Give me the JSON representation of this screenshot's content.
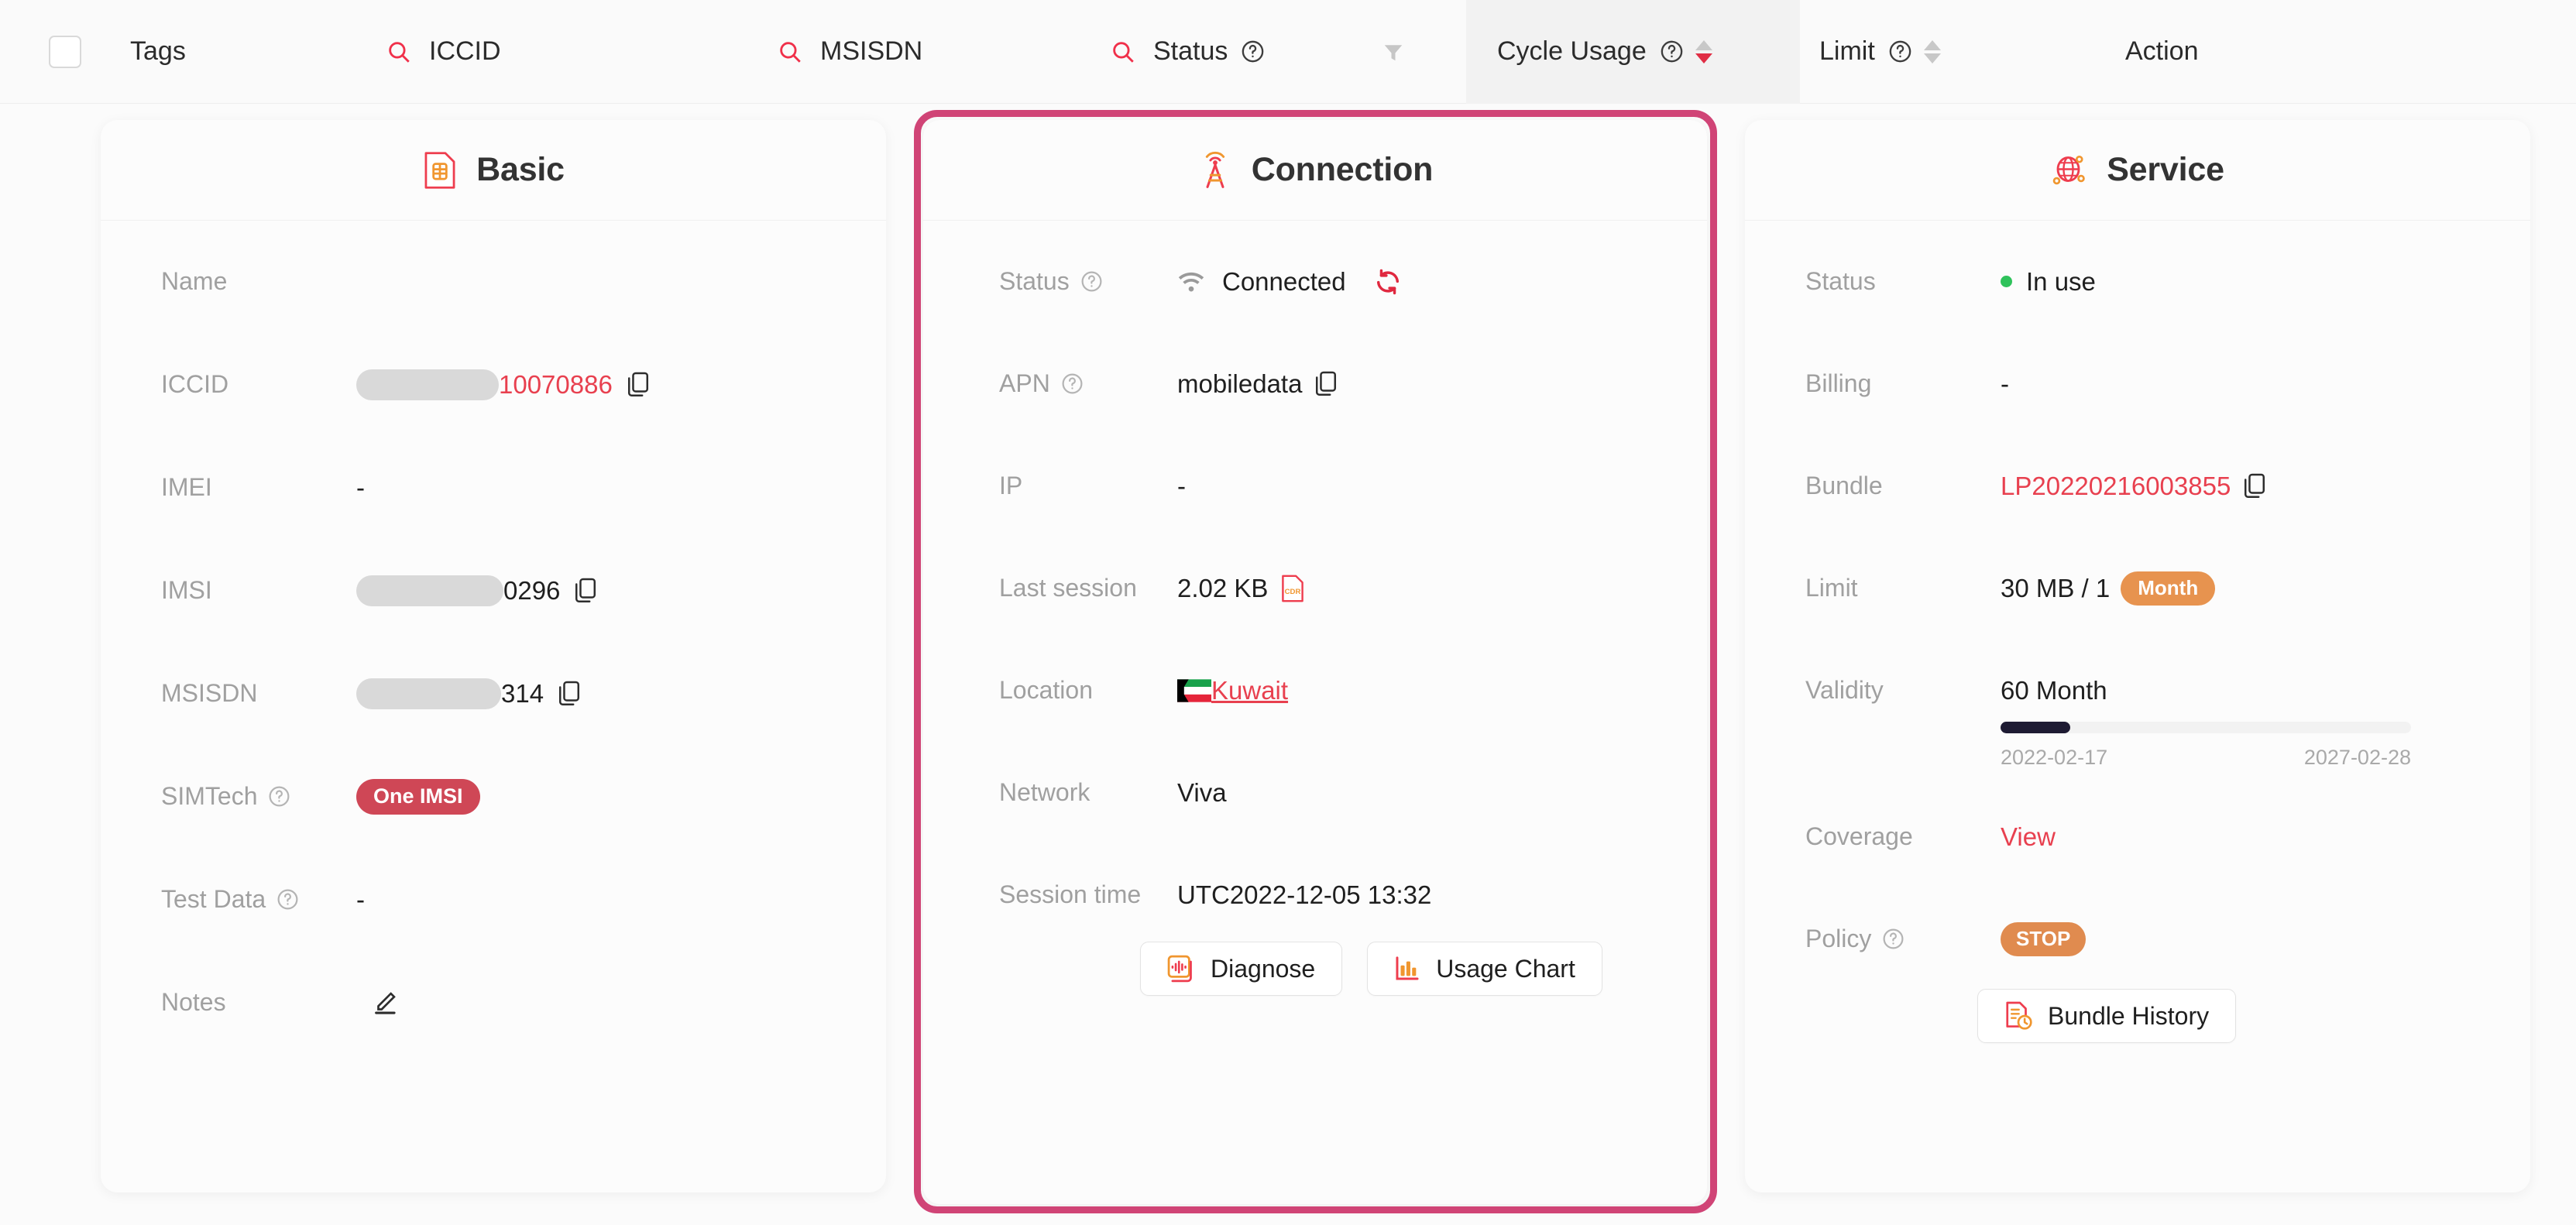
{
  "table_header": {
    "checkbox_checked": false,
    "columns": [
      {
        "label": "Tags",
        "icon": null,
        "help": false,
        "sort": false,
        "filter": false,
        "highlight": false
      },
      {
        "label": "ICCID",
        "icon": "search-icon",
        "help": false,
        "sort": false,
        "filter": false,
        "highlight": false
      },
      {
        "label": "MSISDN",
        "icon": "search-icon",
        "help": false,
        "sort": false,
        "filter": false,
        "highlight": false
      },
      {
        "label": "Status",
        "icon": "search-icon",
        "help": true,
        "sort": false,
        "filter": true,
        "highlight": false
      },
      {
        "label": "Cycle Usage",
        "icon": null,
        "help": true,
        "sort": true,
        "filter": false,
        "highlight": true
      },
      {
        "label": "Limit",
        "icon": null,
        "help": true,
        "sort": true,
        "filter": false,
        "highlight": false
      },
      {
        "label": "Action",
        "icon": null,
        "help": false,
        "sort": false,
        "filter": false,
        "highlight": false
      }
    ]
  },
  "basic_card": {
    "title": "Basic",
    "icon": "sim-card-icon",
    "rows": {
      "name_label": "Name",
      "name_value": "",
      "iccid_label": "ICCID",
      "iccid_value": "10070886",
      "imei_label": "IMEI",
      "imei_value": "-",
      "imsi_label": "IMSI",
      "imsi_value": "0296",
      "msisdn_label": "MSISDN",
      "msisdn_value": "314",
      "simtech_label": "SIMTech",
      "simtech_value": "One IMSI",
      "testdata_label": "Test Data",
      "testdata_value": "-",
      "notes_label": "Notes",
      "notes_icon": "pencil-edit-icon"
    }
  },
  "connection_card": {
    "title": "Connection",
    "icon": "cell-tower-icon",
    "highlighted": true,
    "highlight_color": "#d04476",
    "rows": {
      "status_label": "Status",
      "status_value": "Connected",
      "status_icon": "wifi-icon",
      "refresh_icon": "refresh-icon",
      "apn_label": "APN",
      "apn_value": "mobiledata",
      "ip_label": "IP",
      "ip_value": "-",
      "last_session_label": "Last session",
      "last_session_value": "2.02 KB",
      "cdr_icon": "cdr-file-icon",
      "location_label": "Location",
      "location_value": "Kuwait",
      "location_flag": "kuwait-flag-icon",
      "network_label": "Network",
      "network_value": "Viva",
      "session_time_label": "Session time",
      "session_time_value": "UTC2022-12-05 13:32"
    },
    "buttons": [
      {
        "label": "Diagnose",
        "icon": "diagnose-icon"
      },
      {
        "label": "Usage Chart",
        "icon": "bar-chart-icon"
      }
    ]
  },
  "service_card": {
    "title": "Service",
    "icon": "globe-network-icon",
    "rows": {
      "status_label": "Status",
      "status_value": "In use",
      "status_dot_color": "#2fc25b",
      "billing_label": "Billing",
      "billing_value": "-",
      "bundle_label": "Bundle",
      "bundle_value": "LP20220216003855",
      "limit_label": "Limit",
      "limit_value": "30 MB / 1",
      "limit_badge": "Month",
      "validity_label": "Validity",
      "validity_value": "60 Month",
      "validity_progress_percent": 17,
      "validity_start": "2022-02-17",
      "validity_end": "2027-02-28",
      "coverage_label": "Coverage",
      "coverage_value": "View",
      "policy_label": "Policy",
      "policy_value": "STOP"
    },
    "buttons": [
      {
        "label": "Bundle History",
        "icon": "bundle-history-icon"
      }
    ]
  },
  "colors": {
    "accent_red": "#e8404f",
    "highlight_pink": "#d04476",
    "badge_orange": "#e7934f",
    "badge_red": "#cf4756",
    "status_green": "#2fc25b",
    "progress_dark": "#1e1b33"
  }
}
